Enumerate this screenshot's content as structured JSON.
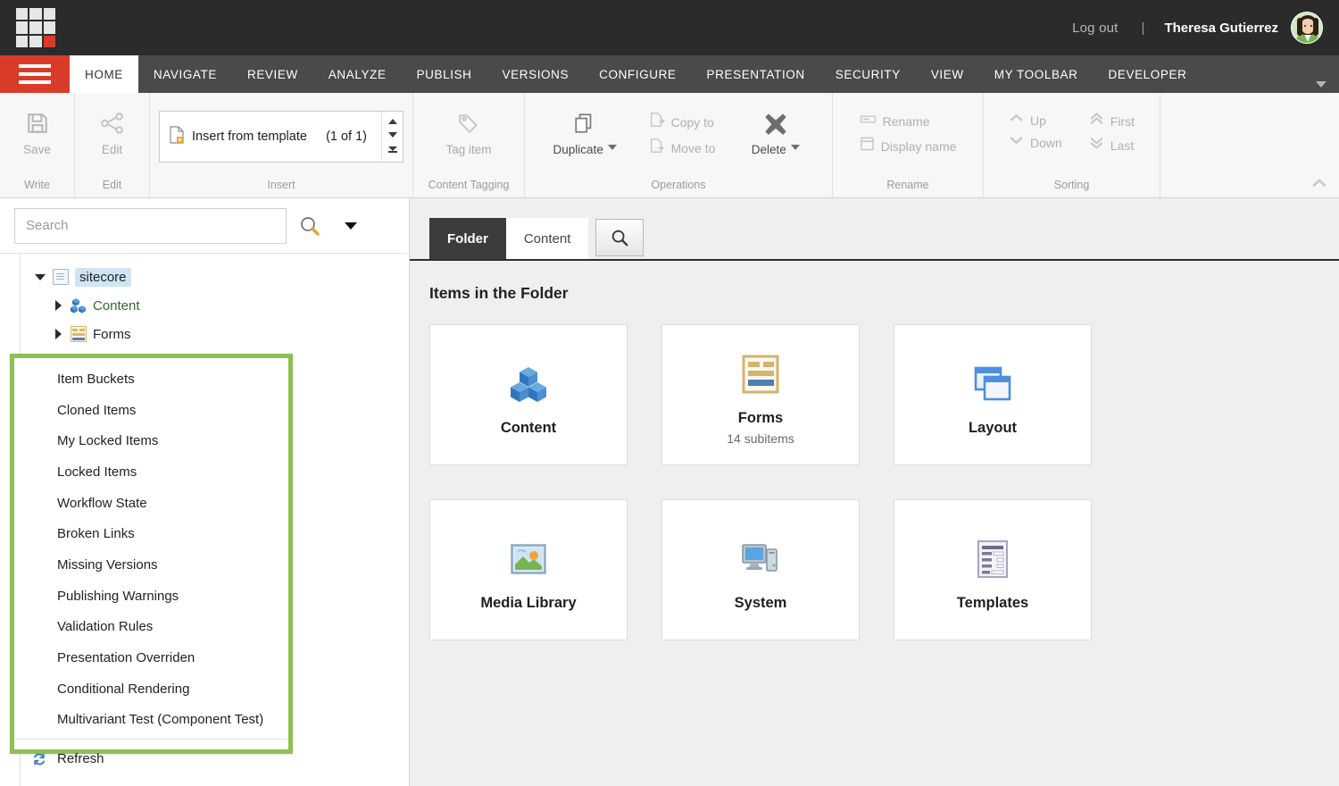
{
  "topbar": {
    "logo_name": "sitecore-logo",
    "logout_label": "Log out",
    "separator": "|",
    "user_name": "Theresa Gutierrez",
    "avatar_name": "user-avatar"
  },
  "menubar": {
    "hamburger_name": "main-menu-button",
    "tabs": [
      {
        "label": "HOME",
        "active": true
      },
      {
        "label": "NAVIGATE",
        "active": false
      },
      {
        "label": "REVIEW",
        "active": false
      },
      {
        "label": "ANALYZE",
        "active": false
      },
      {
        "label": "PUBLISH",
        "active": false
      },
      {
        "label": "VERSIONS",
        "active": false
      },
      {
        "label": "CONFIGURE",
        "active": false
      },
      {
        "label": "PRESENTATION",
        "active": false
      },
      {
        "label": "SECURITY",
        "active": false
      },
      {
        "label": "VIEW",
        "active": false
      },
      {
        "label": "MY TOOLBAR",
        "active": false
      },
      {
        "label": "DEVELOPER",
        "active": false
      }
    ]
  },
  "ribbon": {
    "groups": [
      {
        "label": "Write"
      },
      {
        "label": "Edit"
      },
      {
        "label": "Insert"
      },
      {
        "label": "Content Tagging"
      },
      {
        "label": "Operations"
      },
      {
        "label": "Rename"
      },
      {
        "label": "Sorting"
      }
    ],
    "save_label": "Save",
    "edit_label": "Edit",
    "insert_template_label": "Insert from template",
    "insert_count": "(1 of 1)",
    "tag_item_label": "Tag item",
    "duplicate_label": "Duplicate",
    "copy_to_label": "Copy to",
    "move_to_label": "Move to",
    "delete_label": "Delete",
    "rename_label": "Rename",
    "display_name_label": "Display name",
    "up_label": "Up",
    "down_label": "Down",
    "first_label": "First",
    "last_label": "Last"
  },
  "sidebar": {
    "search": {
      "value": "",
      "placeholder": "Search"
    },
    "tree": [
      {
        "label": "sitecore",
        "icon": "document-icon",
        "expanded": true,
        "selected": true,
        "indent": 0
      },
      {
        "label": "Content",
        "icon": "cubes-icon",
        "expanded": false,
        "selected": false,
        "indent": 1
      },
      {
        "label": "Forms",
        "icon": "forms-icon",
        "expanded": false,
        "selected": false,
        "indent": 1
      }
    ]
  },
  "context_menu": {
    "items": [
      {
        "label": "Item Buckets",
        "icon": ""
      },
      {
        "label": "Cloned Items",
        "icon": ""
      },
      {
        "label": "My Locked Items",
        "icon": ""
      },
      {
        "label": "Locked Items",
        "icon": ""
      },
      {
        "label": "Workflow State",
        "icon": ""
      },
      {
        "label": "Broken Links",
        "icon": ""
      },
      {
        "label": "Missing Versions",
        "icon": ""
      },
      {
        "label": "Publishing Warnings",
        "icon": ""
      },
      {
        "label": "Validation Rules",
        "icon": ""
      },
      {
        "label": "Presentation Overriden",
        "icon": ""
      },
      {
        "label": "Conditional Rendering",
        "icon": ""
      },
      {
        "label": "Multivariant Test (Component Test)",
        "icon": ""
      }
    ],
    "footer_item": {
      "label": "Refresh",
      "icon": "refresh-icon"
    },
    "highlight_color": "#8dc153"
  },
  "main": {
    "tabs": [
      {
        "label": "Folder",
        "active": true
      },
      {
        "label": "Content",
        "active": false
      }
    ],
    "search_tab_icon": "search-icon",
    "title": "Items in the Folder",
    "cards": [
      {
        "name": "Content",
        "subtitle": "",
        "icon": "cubes-icon"
      },
      {
        "name": "Forms",
        "subtitle": "14 subitems",
        "icon": "forms-icon"
      },
      {
        "name": "Layout",
        "subtitle": "",
        "icon": "layout-windows-icon"
      },
      {
        "name": "Media Library",
        "subtitle": "",
        "icon": "image-icon"
      },
      {
        "name": "System",
        "subtitle": "",
        "icon": "computer-icon"
      },
      {
        "name": "Templates",
        "subtitle": "",
        "icon": "template-document-icon"
      }
    ]
  },
  "colors": {
    "accent_red": "#d93b29",
    "dark_header": "#2b2b2b",
    "menu_bar": "#4a4a4a",
    "highlight_green": "#8dc153",
    "selection_blue": "#cfe5f5"
  }
}
